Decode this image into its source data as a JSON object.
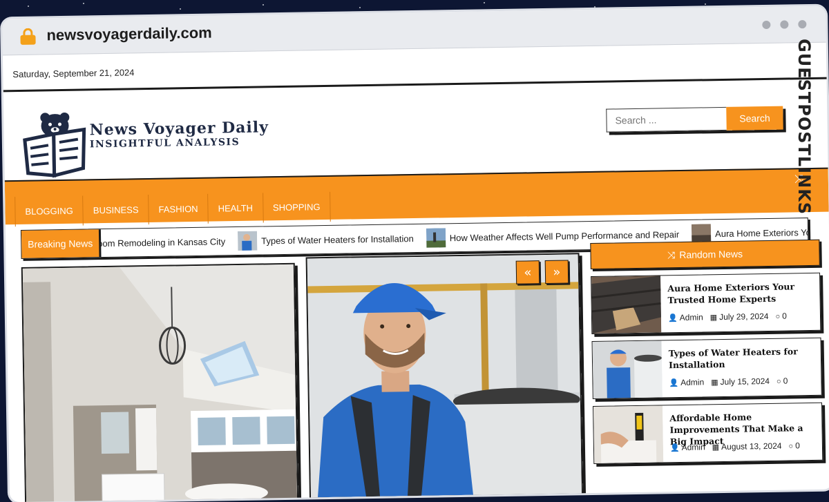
{
  "browser": {
    "url": "newsvoyagerdaily.com"
  },
  "topbar": {
    "date": "Saturday, September 21, 2024"
  },
  "brand": {
    "title": "News Voyager Daily",
    "tagline": "INSIGHTFUL ANALYSIS"
  },
  "search": {
    "placeholder": "Search ...",
    "button_label": "Search"
  },
  "nav": {
    "items": [
      "BLOGGING",
      "BUSINESS",
      "FASHION",
      "HEALTH",
      "SHOPPING"
    ]
  },
  "ticker": {
    "label": "Breaking News",
    "items": [
      "oom Remodeling in Kansas City",
      "Types of Water Heaters for Installation",
      "How Weather Affects Well Pump Performance and Repair",
      "Aura Home Exteriors Your Trus"
    ]
  },
  "slider": {
    "prev_label": "«",
    "next_label": "»"
  },
  "sidebar": {
    "random_label": "Random News",
    "posts": [
      {
        "title": "Aura Home Exteriors Your Trusted Home Experts",
        "author": "Admin",
        "date": "July 29, 2024",
        "comments": "0"
      },
      {
        "title": "Types of Water Heaters for Installation",
        "author": "Admin",
        "date": "July 15, 2024",
        "comments": "0"
      },
      {
        "title": "Affordable Home Improvements That Make a Big Impact",
        "author": "Admin",
        "date": "August 13, 2024",
        "comments": "0"
      }
    ]
  },
  "watermark": {
    "text": "GUESTPOSTLINKS"
  },
  "colors": {
    "accent": "#f7931e",
    "dark": "#1a1a1a",
    "navy": "#1f2a44"
  }
}
